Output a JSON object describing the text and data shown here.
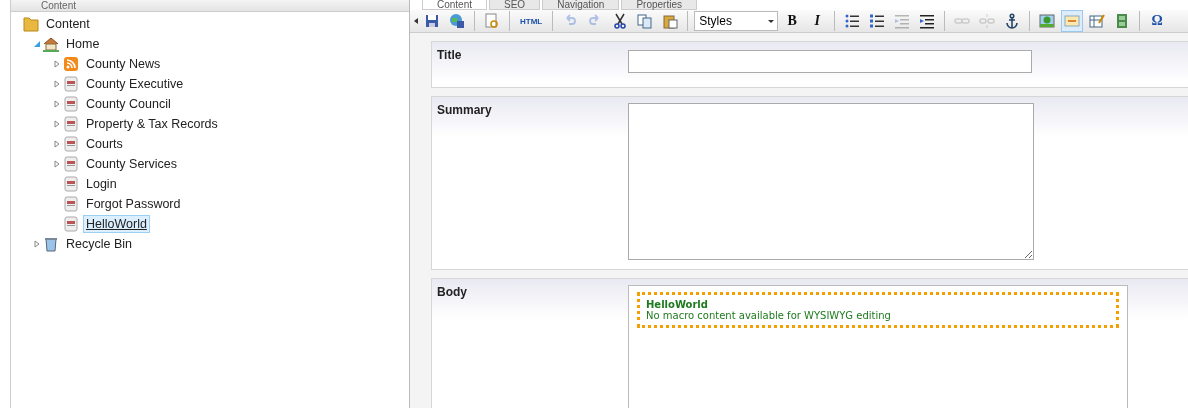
{
  "left_panel": {
    "title": "Content"
  },
  "tree": [
    {
      "label": "Content",
      "kind": "folder",
      "selected": false,
      "children": [
        {
          "label": "Home",
          "kind": "home",
          "expanded": true,
          "selected": false,
          "children": [
            {
              "label": "County News",
              "kind": "rss",
              "expanded": false,
              "selected": false
            },
            {
              "label": "County Executive",
              "kind": "page",
              "expanded": false,
              "selected": false
            },
            {
              "label": "County Council",
              "kind": "page",
              "expanded": false,
              "selected": false
            },
            {
              "label": "Property & Tax Records",
              "kind": "page",
              "expanded": false,
              "selected": false
            },
            {
              "label": "Courts",
              "kind": "page",
              "expanded": false,
              "selected": false
            },
            {
              "label": "County Services",
              "kind": "page",
              "expanded": false,
              "selected": false
            },
            {
              "label": "Login",
              "kind": "page",
              "selected": false
            },
            {
              "label": "Forgot Password",
              "kind": "page",
              "selected": false
            },
            {
              "label": "HelloWorld",
              "kind": "page",
              "selected": true
            }
          ]
        },
        {
          "label": "Recycle Bin",
          "kind": "recycle",
          "expanded": false,
          "selected": false
        }
      ]
    }
  ],
  "tabs": [
    {
      "label": "Content",
      "selected": true
    },
    {
      "label": "SEO",
      "selected": false
    },
    {
      "label": "Navigation",
      "selected": false
    },
    {
      "label": "Properties",
      "selected": false
    }
  ],
  "toolbar": [
    {
      "kind": "icon",
      "disabled": false,
      "selected": false
    },
    {
      "kind": "icon",
      "disabled": false,
      "selected": false
    },
    {
      "kind": "separator"
    },
    {
      "kind": "icon",
      "disabled": false,
      "selected": false
    },
    {
      "kind": "separator"
    },
    {
      "kind": "text",
      "label": "HTML",
      "disabled": false,
      "selected": false
    },
    {
      "kind": "separator"
    },
    {
      "kind": "icon",
      "disabled": true,
      "selected": false
    },
    {
      "kind": "icon",
      "disabled": true,
      "selected": false
    },
    {
      "kind": "icon",
      "disabled": false,
      "selected": false
    },
    {
      "kind": "icon",
      "disabled": false,
      "selected": false
    },
    {
      "kind": "icon",
      "disabled": false,
      "selected": false
    },
    {
      "kind": "separator"
    },
    {
      "kind": "select",
      "label": "Styles"
    },
    {
      "kind": "text",
      "label": "B",
      "disabled": false,
      "selected": false
    },
    {
      "kind": "text",
      "label": "I",
      "disabled": false,
      "selected": false
    },
    {
      "kind": "separator"
    },
    {
      "kind": "icon",
      "disabled": false,
      "selected": false
    },
    {
      "kind": "icon",
      "disabled": false,
      "selected": false
    },
    {
      "kind": "icon",
      "disabled": true,
      "selected": false
    },
    {
      "kind": "icon",
      "disabled": false,
      "selected": false
    },
    {
      "kind": "separator"
    },
    {
      "kind": "icon",
      "disabled": true,
      "selected": false
    },
    {
      "kind": "icon",
      "disabled": true,
      "selected": false
    },
    {
      "kind": "icon",
      "disabled": false,
      "selected": false
    },
    {
      "kind": "separator"
    },
    {
      "kind": "icon",
      "disabled": false,
      "selected": false
    },
    {
      "kind": "icon",
      "disabled": false,
      "selected": true
    },
    {
      "kind": "icon",
      "disabled": false,
      "selected": false
    },
    {
      "kind": "icon",
      "disabled": false,
      "selected": false
    },
    {
      "kind": "separator"
    },
    {
      "kind": "text",
      "label": "Ω",
      "disabled": false,
      "selected": false
    }
  ],
  "fields": [
    {
      "label": "Title",
      "kind": "text"
    },
    {
      "label": "Summary",
      "kind": "textarea"
    },
    {
      "label": "Body",
      "kind": "richtext",
      "macro": {
        "title": "HelloWorld",
        "message": "No macro content available for WYSIWYG editing"
      }
    }
  ]
}
